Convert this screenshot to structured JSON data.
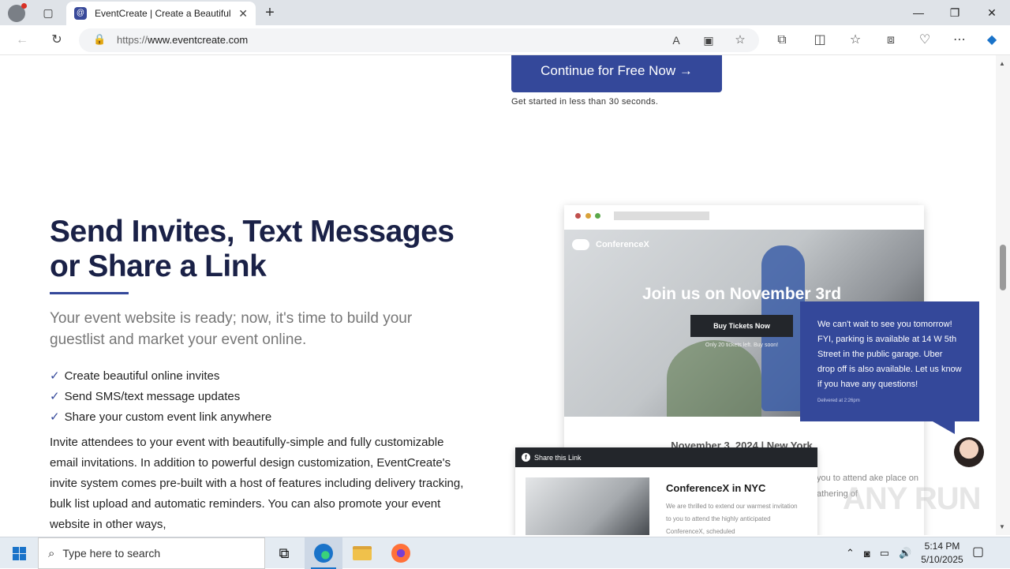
{
  "browser": {
    "tab_title": "EventCreate | Create a Beautiful E",
    "url_proto": "https://",
    "url_host": "www.eventcreate.com",
    "new_tab_icon": "+",
    "close_icon": "✕"
  },
  "page": {
    "cta_label": "Continue for Free Now →",
    "cta_note": "Get started in less than 30 seconds.",
    "heading": "Send Invites, Text Messages or Share a Link",
    "subhead": "Your event website is ready; now, it's time to build your guestlist and market your event online.",
    "checks": [
      "Create beautiful online invites",
      "Send SMS/text message updates",
      "Share your custom event link anywhere"
    ],
    "body": "Invite attendees to your event with beautifully-simple and fully customizable email invitations. In addition to powerful design customization, EventCreate's invite system comes pre-built with a host of features including delivery tracking, bulk list upload and automatic reminders.  You can also promote your event website in other ways,"
  },
  "mockup": {
    "brand": "ConferenceX",
    "join": "Join us on November 3rd",
    "buy": "Buy Tickets Now",
    "tickets_left": "Only 20 tickets left. Buy soon!",
    "event_date": "November 3, 2024 | New York",
    "text_partial": "you to attend ake place on athering of",
    "bubble_text": "We can't wait to see you tomorrow! FYI, parking is available at 14 W 5th Street in the public garage. Uber drop off is also available. Let us know if you have any questions!",
    "bubble_delivered": "Delivered at 2:26pm",
    "share_header": "Share this Link",
    "share_title": "ConferenceX in NYC",
    "share_desc": "We are thrilled to extend our warmest invitation to you to attend the highly anticipated ConferenceX, scheduled"
  },
  "watermark": "ANY RUN",
  "taskbar": {
    "search_placeholder": "Type here to search",
    "time": "5:14 PM",
    "date": "5/10/2025"
  },
  "colors": {
    "brand_blue": "#34489a",
    "heading_navy": "#1a2147"
  }
}
